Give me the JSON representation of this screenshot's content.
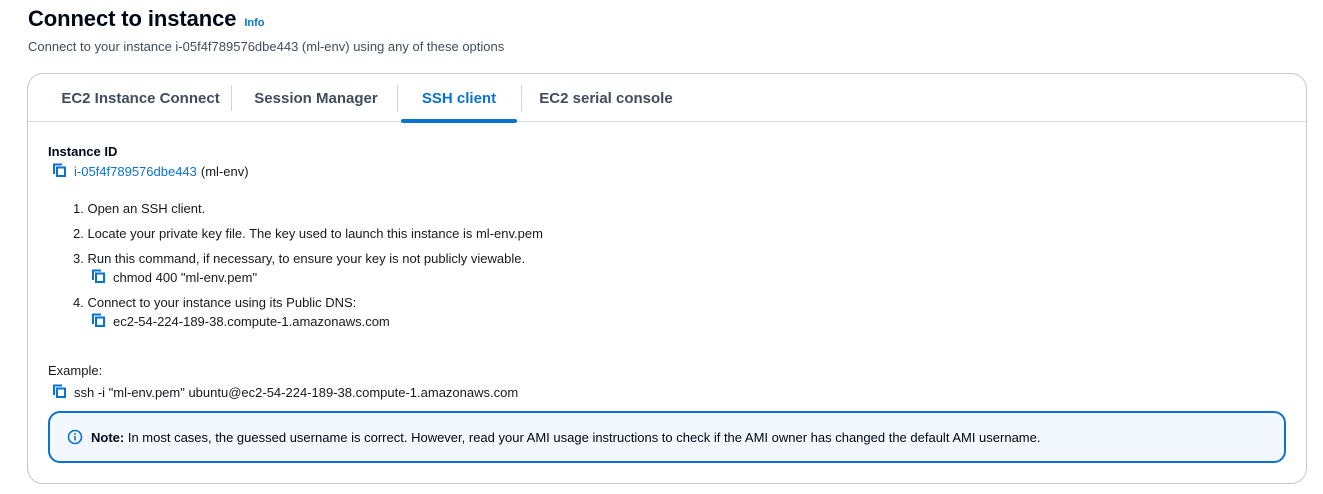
{
  "header": {
    "title": "Connect to instance",
    "info_label": "Info",
    "description": "Connect to your instance i-05f4f789576dbe443 (ml-env) using any of these options"
  },
  "tabs": [
    {
      "label": "EC2 Instance Connect",
      "active": false
    },
    {
      "label": "Session Manager",
      "active": false
    },
    {
      "label": "SSH client",
      "active": true
    },
    {
      "label": "EC2 serial console",
      "active": false
    }
  ],
  "instance": {
    "label": "Instance ID",
    "id": "i-05f4f789576dbe443",
    "name_suffix": "(ml-env)"
  },
  "steps": [
    {
      "text": "1. Open an SSH client."
    },
    {
      "text": "2. Locate your private key file. The key used to launch this instance is ml-env.pem"
    },
    {
      "text": "3. Run this command, if necessary, to ensure your key is not publicly viewable.",
      "command": "chmod 400 \"ml-env.pem\""
    },
    {
      "text": "4. Connect to your instance using its Public DNS:",
      "command": "ec2-54-224-189-38.compute-1.amazonaws.com"
    }
  ],
  "example": {
    "label": "Example:",
    "command": "ssh -i \"ml-env.pem\" ubuntu@ec2-54-224-189-38.compute-1.amazonaws.com"
  },
  "note": {
    "strong": "Note:",
    "text": " In most cases, the guessed username is correct. However, read your AMI usage instructions to check if the AMI owner has changed the default AMI username."
  },
  "icons": {
    "copy": "copy-icon",
    "info": "info-circle-icon"
  },
  "colors": {
    "accent": "#0972d3",
    "text": "#16191f",
    "secondary_text": "#414d5c",
    "alert_bg": "#f2f8fd"
  }
}
